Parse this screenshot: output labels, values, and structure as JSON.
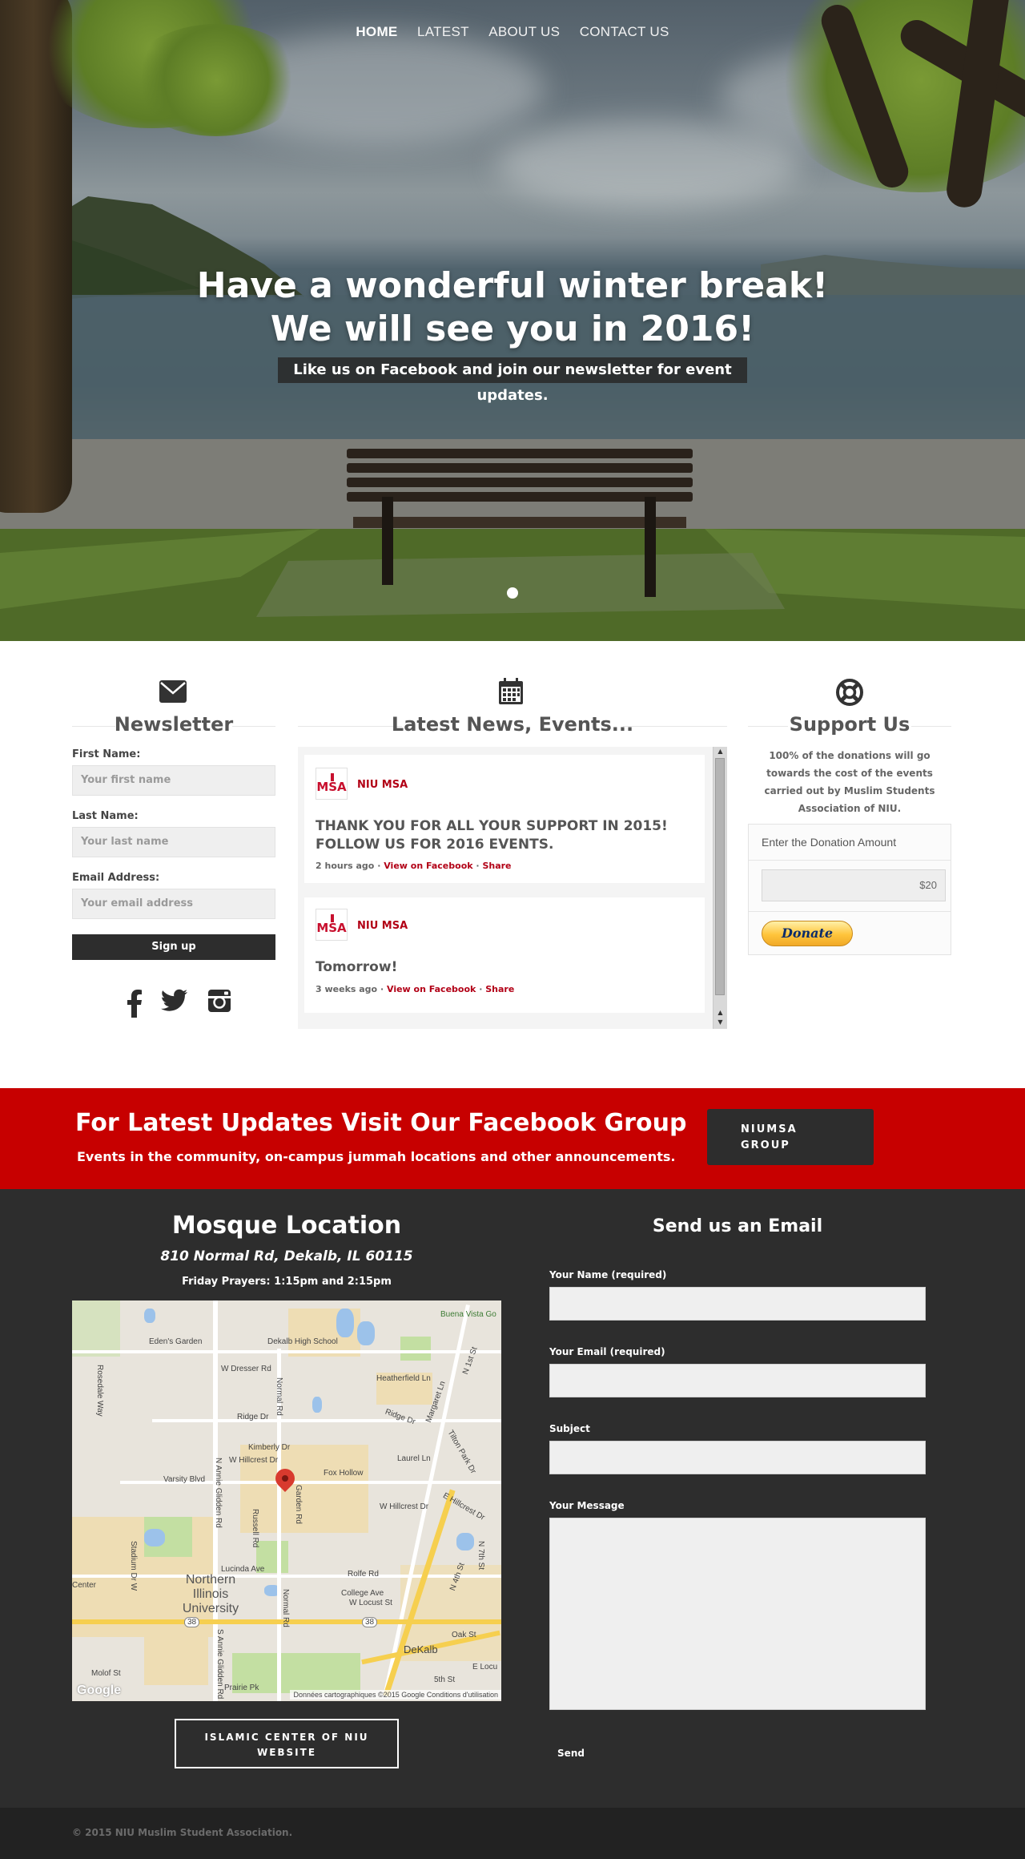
{
  "nav": {
    "items": [
      {
        "label": "HOME"
      },
      {
        "label": "LATEST"
      },
      {
        "label": "ABOUT US"
      },
      {
        "label": "CONTACT US"
      }
    ]
  },
  "hero": {
    "title_line1": "Have a wonderful winter break!",
    "title_line2": "We will see you in 2016!",
    "subtitle": "Like us on Facebook and join our newsletter for event updates."
  },
  "newsletter": {
    "title": "Newsletter",
    "icon": "envelope-icon",
    "first_name_label": "First Name:",
    "first_name_placeholder": "Your first name",
    "last_name_label": "Last Name:",
    "last_name_placeholder": "Your last name",
    "email_label": "Email Address:",
    "email_placeholder": "Your email address",
    "signup_label": "Sign up",
    "social": [
      {
        "icon": "facebook-icon",
        "glyph": "f"
      },
      {
        "icon": "twitter-icon",
        "glyph": "t"
      },
      {
        "icon": "instagram-icon",
        "glyph": "◘"
      }
    ]
  },
  "news": {
    "title": "Latest News, Events...",
    "icon": "calendar-icon",
    "posts": [
      {
        "author": "NIU MSA",
        "logo_text": "MSA",
        "text_line1": "THANK YOU FOR ALL YOUR SUPPORT IN 2015!",
        "text_line2": "FOLLOW US FOR 2016 EVENTS.",
        "time": "2 hours ago",
        "view_label": "View on Facebook",
        "share_label": "Share"
      },
      {
        "author": "NIU MSA",
        "logo_text": "MSA",
        "text_line1": "Tomorrow!",
        "time": "3 weeks ago",
        "view_label": "View on Facebook",
        "share_label": "Share"
      }
    ],
    "separator": "·"
  },
  "support": {
    "title": "Support Us",
    "icon": "lifebuoy-icon",
    "text": "100% of the donations will go towards the cost of the events carried out by Muslim Students Association of NIU.",
    "donation_label": "Enter the Donation Amount",
    "amount": "$20",
    "donate_label": "Donate"
  },
  "banner": {
    "title": "For Latest Updates Visit Our Facebook Group",
    "subtitle": "Events in the community, on-campus jummah locations and other announcements.",
    "button_line1": "NIUMSA",
    "button_line2": "GROUP",
    "color": "#c70000"
  },
  "mosque": {
    "title": "Mosque Location",
    "address": "810  Normal Rd, Dekalb, IL 60115",
    "prayer": "Friday Prayers: 1:15pm and 2:15pm",
    "website_line1": "ISLAMIC CENTER OF NIU",
    "website_line2": "WEBSITE",
    "map": {
      "labels": [
        "Buena Vista Go",
        "Eden's Garden",
        "Dekalb High School",
        "Rosedale Way",
        "W Dresser Rd",
        "Normal Rd",
        "Heatherfield Ln",
        "N 1st St",
        "Ridge Dr",
        "Ridge Dr",
        "Margaret Ln",
        "Kimberly Dr",
        "Tilton Park Dr",
        "Laurel Ln",
        "Varsity Blvd",
        "W Hillcrest Dr",
        "Fox Hollow",
        "Garden Rd",
        "W Hillcrest Dr",
        "E Hillcrest Dr",
        "N Annie Glidden Rd",
        "Russell Rd",
        "Lucinda Ave",
        "Rolfe Rd",
        "College Ave",
        "W Locust St",
        "N 4th St",
        "N 7th St",
        "Stadium Dr W",
        "Oak St",
        "DeKalb",
        "Normal Rd",
        "S Annie Glidden Rd",
        "Prairie Pk",
        "Molof St",
        "5th St",
        "E Locu",
        "Center"
      ],
      "campus_line1": "Northern",
      "campus_line2": "Illinois",
      "campus_line3": "University",
      "route": "38",
      "google": "Google",
      "attribution": "Données cartographiques ©2015 Google   Conditions d'utilisation"
    }
  },
  "email": {
    "title": "Send us an Email",
    "name_label": "Your Name (required)",
    "email_label": "Your Email (required)",
    "subject_label": "Subject",
    "message_label": "Your Message",
    "send_label": "Send"
  },
  "footer": {
    "copyright": "© 2015 NIU Muslim Student Association."
  }
}
